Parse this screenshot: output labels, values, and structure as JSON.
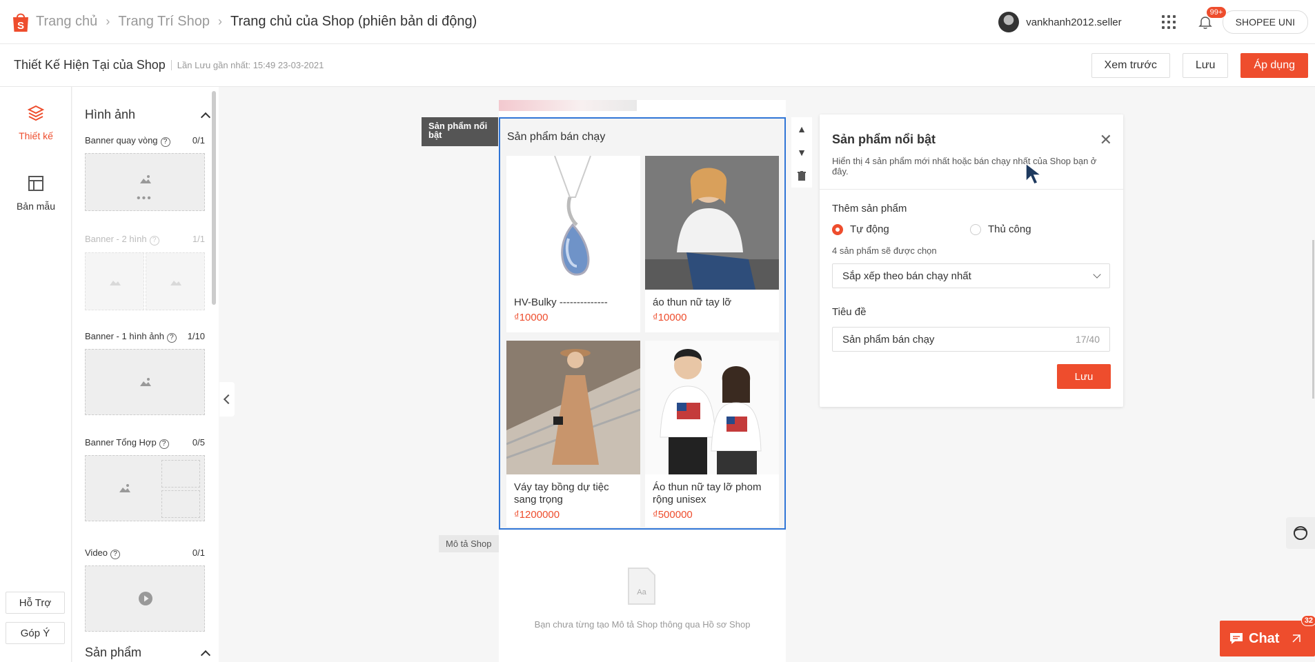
{
  "nav": {
    "breadcrumbs": [
      "Trang chủ",
      "Trang Trí Shop",
      "Trang chủ của Shop (phiên bản di động)"
    ],
    "username": "vankhanh2012.seller",
    "notification_count": "99+",
    "shop_button": "SHOPEE UNI"
  },
  "subheader": {
    "title": "Thiết Kế Hiện Tại của Shop",
    "last_saved": "Lần Lưu gần nhất: 15:49 23-03-2021",
    "preview_label": "Xem trước",
    "save_label": "Lưu",
    "apply_label": "Áp dụng"
  },
  "rail": {
    "design_label": "Thiết kế",
    "templates_label": "Bản mẫu",
    "support_label": "Hỗ Trợ",
    "feedback_label": "Góp Ý"
  },
  "panel": {
    "images_heading": "Hình ảnh",
    "products_heading": "Sản phẩm",
    "components": [
      {
        "label": "Banner quay vòng",
        "count": "0/1"
      },
      {
        "label": "Banner - 2 hình",
        "count": "1/1"
      },
      {
        "label": "Banner - 1 hình ảnh",
        "count": "1/10"
      },
      {
        "label": "Banner Tổng Hợp",
        "count": "0/5"
      },
      {
        "label": "Video",
        "count": "0/1"
      }
    ]
  },
  "canvas": {
    "featured_tag": "Sản phẩm nổi bật",
    "featured_title": "Sản phẩm bán chạy",
    "products": [
      {
        "name": "HV-Bulky --------------",
        "price": "₫10000"
      },
      {
        "name": "áo thun nữ tay lỡ",
        "price": "₫10000"
      },
      {
        "name": "Váy tay bồng dự tiệc sang trọng",
        "price": "₫1200000"
      },
      {
        "name": "Áo thun nữ tay lỡ phom rộng unisex",
        "price": "₫500000"
      }
    ],
    "description_tag": "Mô tả Shop",
    "description_empty": "Bạn chưa từng tạo Mô tả Shop thông qua Hồ sơ Shop",
    "description_icon_text": "Aa"
  },
  "settings": {
    "title": "Sản phẩm nổi bật",
    "description": "Hiển thị 4 sản phẩm mới nhất hoặc bán chạy nhất của Shop bạn ở đây.",
    "add_products_label": "Thêm sản phẩm",
    "option_auto": "Tự động",
    "option_manual": "Thủ công",
    "selected_mode": "auto",
    "count_note": "4 sản phẩm sẽ được chọn",
    "sort_value": "Sắp xếp theo bán chạy nhất",
    "title_label": "Tiêu đề",
    "title_value": "Sản phẩm bán chạy",
    "title_counter": "17/40",
    "save_label": "Lưu"
  },
  "chat": {
    "label": "Chat",
    "badge": "32"
  },
  "colors": {
    "brand": "#ee4d2d",
    "selection": "#2f75d6"
  }
}
